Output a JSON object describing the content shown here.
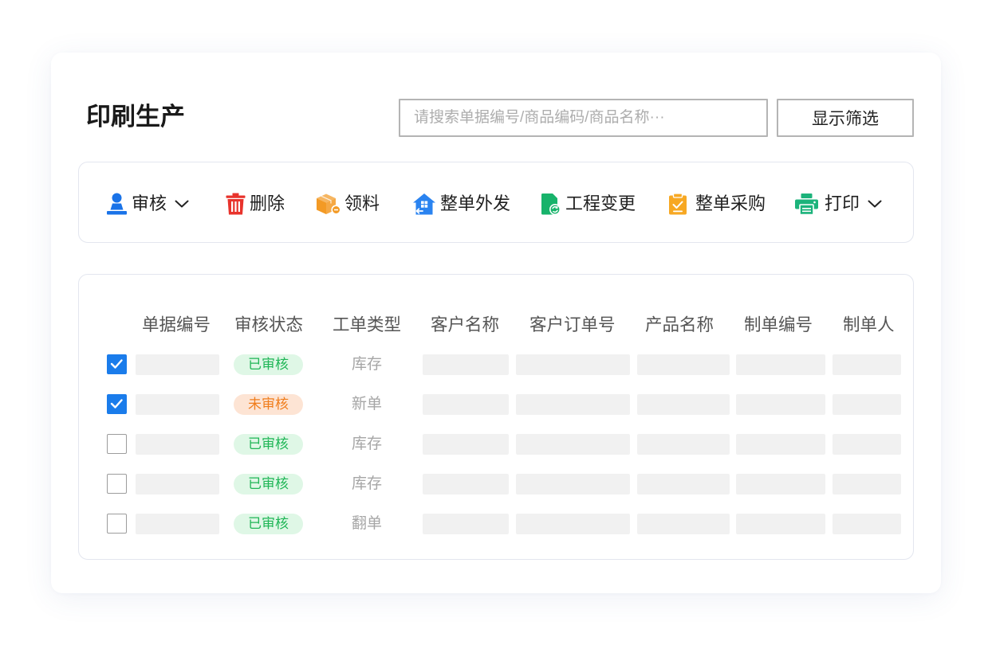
{
  "page": {
    "title": "印刷生产"
  },
  "search": {
    "placeholder": "请搜索单据编号/商品编码/商品名称···",
    "value": ""
  },
  "filter_button": {
    "label": "显示筛选"
  },
  "toolbar": {
    "items": [
      {
        "label": "审核",
        "icon": "person-stamp-icon",
        "has_dropdown": true,
        "color": "#1a73e8"
      },
      {
        "label": "删除",
        "icon": "trash-icon",
        "has_dropdown": false,
        "color": "#e8332c"
      },
      {
        "label": "领料",
        "icon": "box-icon",
        "has_dropdown": false,
        "color": "#f39a25"
      },
      {
        "label": "整单外发",
        "icon": "house-arrow-icon",
        "has_dropdown": false,
        "color": "#2a83f0"
      },
      {
        "label": "工程变更",
        "icon": "document-refresh-icon",
        "has_dropdown": false,
        "color": "#18b36b"
      },
      {
        "label": "整单采购",
        "icon": "clipboard-check-icon",
        "has_dropdown": false,
        "color": "#f7a823"
      },
      {
        "label": "打印",
        "icon": "printer-icon",
        "has_dropdown": true,
        "color": "#1cb37b"
      }
    ]
  },
  "table": {
    "columns": [
      "单据编号",
      "审核状态",
      "工单类型",
      "客户名称",
      "客户订单号",
      "产品名称",
      "制单编号",
      "制单人"
    ],
    "rows": [
      {
        "checked": true,
        "status": "已审核",
        "type": "库存"
      },
      {
        "checked": true,
        "status": "未审核",
        "type": "新单"
      },
      {
        "checked": false,
        "status": "已审核",
        "type": "库存"
      },
      {
        "checked": false,
        "status": "已审核",
        "type": "库存"
      },
      {
        "checked": false,
        "status": "已审核",
        "type": "翻单"
      }
    ],
    "status_styles": {
      "已审核": {
        "text": "#1fb656",
        "background": "#dff7e6"
      },
      "未审核": {
        "text": "#f07d1c",
        "background": "#fde4d4"
      }
    }
  },
  "colors": {
    "accent": "#1a7ceb",
    "text": "#1f1f1f",
    "muted": "#a6a6a6",
    "border": "#e3e6ef",
    "placeholder_block": "#f1f1f1"
  }
}
